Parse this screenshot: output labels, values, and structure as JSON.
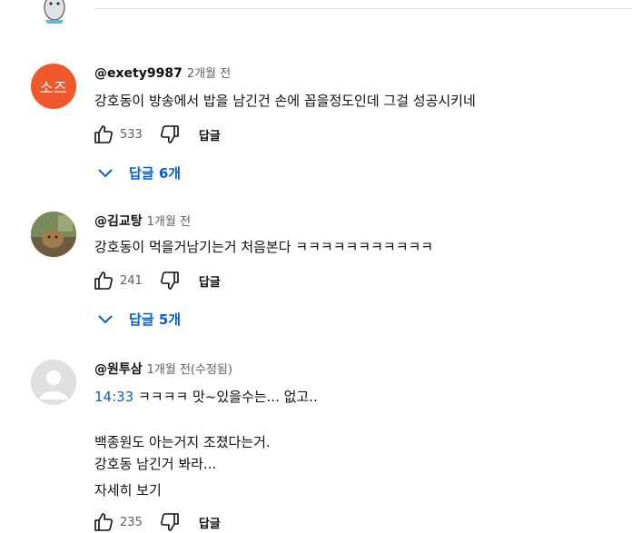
{
  "comments": [
    {
      "author": "@exety9987",
      "time": "2개월 전",
      "avatar_text": "소즈",
      "avatar_color": "#f0572a",
      "text": "강호동이 방송에서 밥을 남긴건 손에 꼽을정도인데 그걸 성공시키네",
      "likes": "533",
      "reply_label": "답글",
      "replies_label": "답글 6개"
    },
    {
      "author": "@김교탕",
      "time": "1개월 전",
      "text": "강호동이 먹을거남기는거 처음본다 ㅋㅋㅋㅋㅋㅋㅋㅋㅋㅋㅋ",
      "likes": "241",
      "reply_label": "답글",
      "replies_label": "답글 5개"
    },
    {
      "author": "@원투삼",
      "time": "1개월 전(수정됨)",
      "timestamp": "14:33",
      "line1": " ㅋㅋㅋㅋ 맛~있을수는... 없고..",
      "line2": "백종원도 아는거지 조졌다는거.",
      "line3": "강호동 남긴거 봐라...",
      "read_more": "자세히 보기",
      "likes": "235",
      "reply_label": "답글"
    }
  ],
  "colors": {
    "link": "#065fd4",
    "secondary_text": "#606060"
  },
  "icons": [
    "thumb-up-icon",
    "thumb-down-icon",
    "chevron-down-icon"
  ]
}
